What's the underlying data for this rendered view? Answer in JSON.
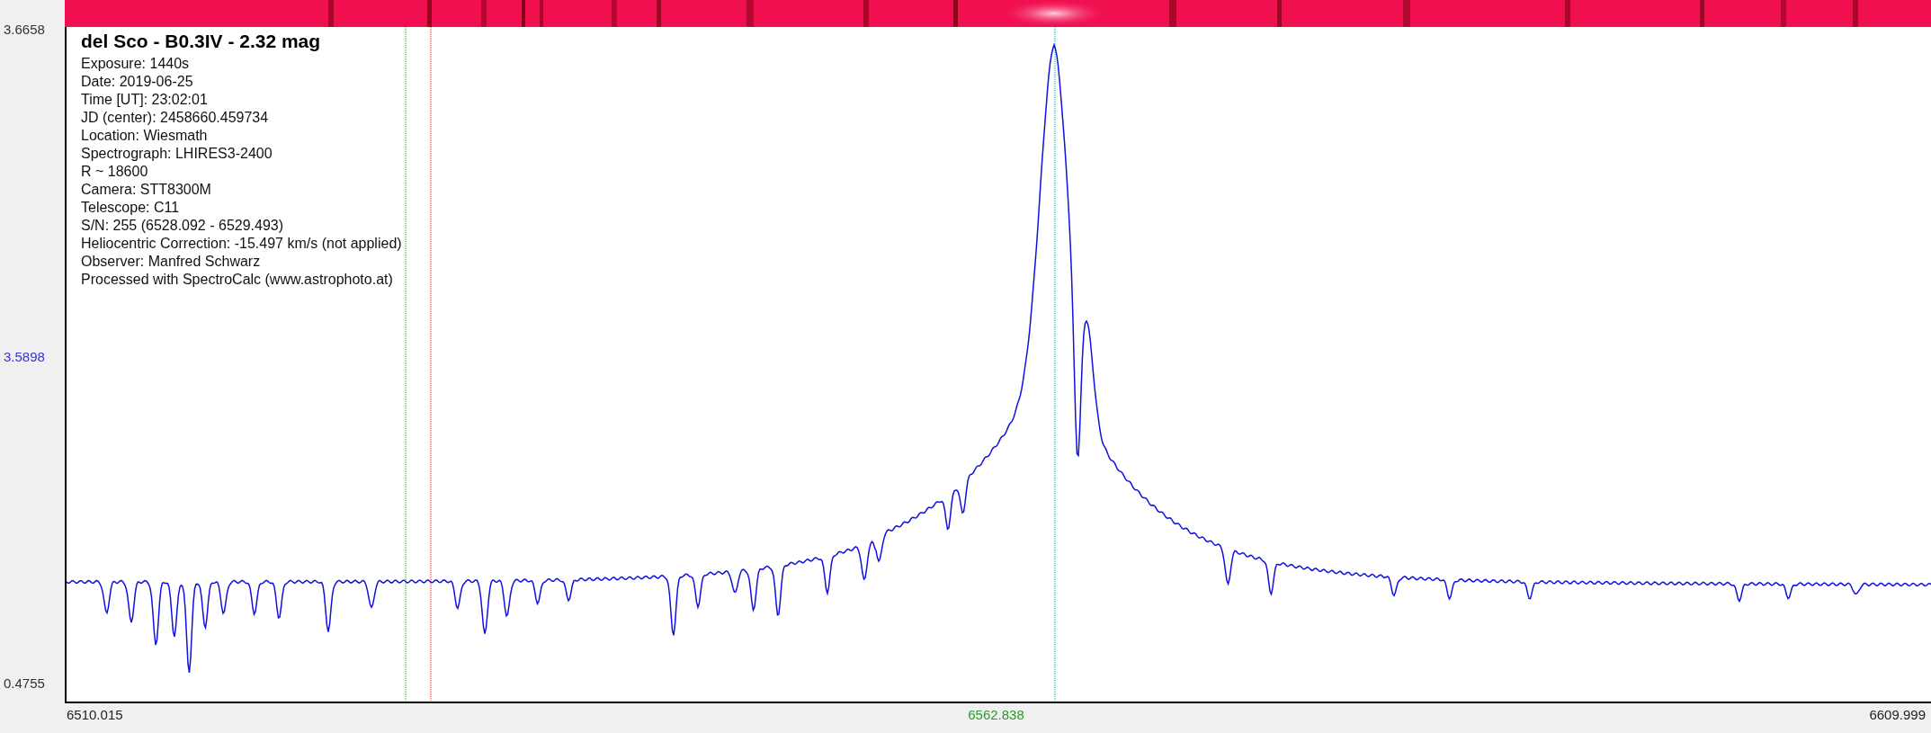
{
  "header": {
    "title": "del Sco - B0.3IV - 2.32 mag",
    "lines": [
      "Exposure: 1440s",
      "Date: 2019-06-25",
      "Time [UT]: 23:02:01",
      "JD (center): 2458660.459734",
      "Location: Wiesmath",
      "Spectrograph: LHIRES3-2400",
      "R ~ 18600",
      "Camera: STT8300M",
      "Telescope: C11",
      "S/N: 255 (6528.092 - 6529.493)",
      "Heliocentric Correction: -15.497 km/s (not applied)",
      "Observer: Manfred Schwarz",
      "Processed with SpectroCalc (www.astrophoto.at)"
    ]
  },
  "y_axis": {
    "ticks": [
      {
        "label": "3.6658",
        "color": "#333333"
      },
      {
        "label": "3.5898",
        "color": "#3333dd"
      },
      {
        "label": "0.4755",
        "color": "#333333"
      }
    ]
  },
  "x_axis": {
    "ticks": [
      {
        "label": "6510.015",
        "color": "#222222"
      },
      {
        "label": "6562.838",
        "color": "#2a9a2a"
      },
      {
        "label": "6609.999",
        "color": "#222222"
      }
    ]
  }
}
